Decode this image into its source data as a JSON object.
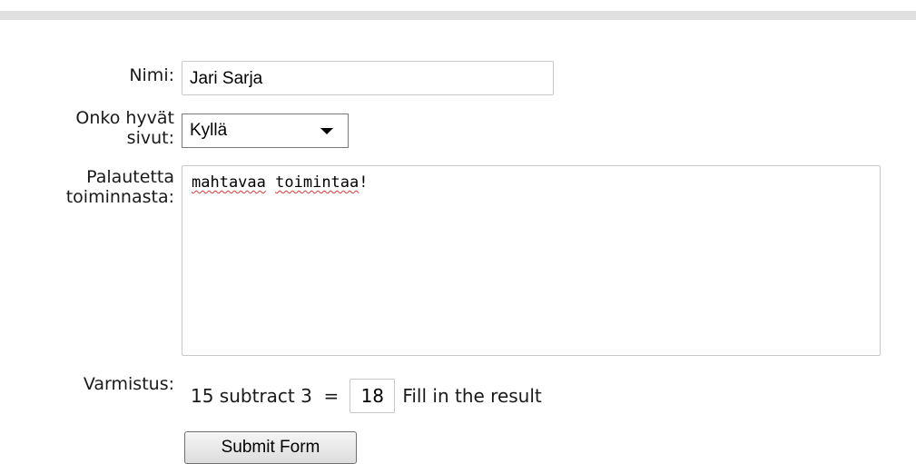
{
  "form": {
    "name_label": "Nimi:",
    "name_value": "Jari Sarja",
    "rating_label_line1": "Onko hyvät",
    "rating_label_line2": "sivut:",
    "rating_value": "Kyllä",
    "feedback_label_line1": "Palautetta",
    "feedback_label_line2": "toiminnasta:",
    "feedback_word1": "mahtavaa",
    "feedback_word2": "toimintaa",
    "feedback_punct": "!",
    "verify_label": "Varmistus:",
    "captcha_question": "15 subtract 3  =",
    "captcha_answer": "18",
    "captcha_hint": "Fill in the result",
    "submit_label": "Submit Form"
  },
  "icons": {
    "select_arrow": "chevron-down-icon"
  },
  "colors": {
    "spellcheck_underline": "#d43a3a",
    "top_bar": "#e0e0e0"
  }
}
